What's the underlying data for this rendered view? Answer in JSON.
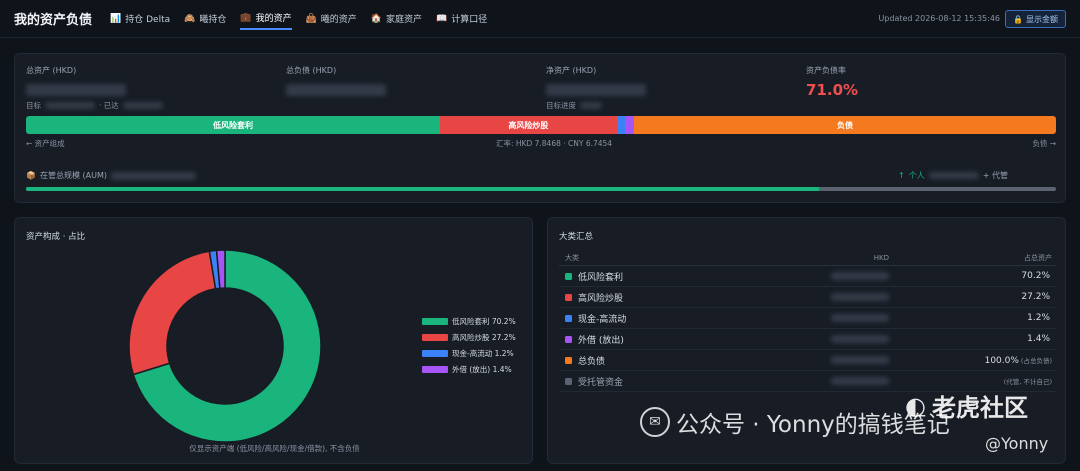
{
  "header": {
    "title": "我的资产负债",
    "nav": [
      {
        "icon": "📊",
        "label": "持仓 Delta",
        "active": false
      },
      {
        "icon": "🙈",
        "label": "曦持仓",
        "active": false
      },
      {
        "icon": "💼",
        "label": "我的资产",
        "active": true
      },
      {
        "icon": "👜",
        "label": "曦的资产",
        "active": false
      },
      {
        "icon": "🏠",
        "label": "家庭资产",
        "active": false
      },
      {
        "icon": "📖",
        "label": "计算口径",
        "active": false
      }
    ],
    "updated": "Updated 2026-08-12 15:35:46",
    "show_button": {
      "icon": "🔒",
      "label": "显示金额"
    }
  },
  "summary": {
    "total_assets_label": "总资产 (HKD)",
    "total_liab_label": "总负债 (HKD)",
    "net_assets_label": "净资产 (HKD)",
    "debt_ratio_label": "资产负债率",
    "debt_ratio_value": "71.0%",
    "target_label": "目标",
    "reached_label": "· 已达",
    "target_progress_label": "目标进度",
    "bar_segments": [
      {
        "label": "低风险套利",
        "share": 41,
        "color": "#19b57c"
      },
      {
        "label": "高风险炒股",
        "share": 17.5,
        "color": "#e84545"
      },
      {
        "label": "",
        "share": 0.8,
        "color": "#3b82f6"
      },
      {
        "label": "",
        "share": 0.9,
        "color": "#a855f7"
      },
      {
        "label": "负债",
        "share": 41.8,
        "color": "#f57a1f"
      }
    ],
    "asset_side_label": "← 资产组成",
    "fx_label": "汇率: HKD 7.8468 · CNY 6.7454",
    "liab_side_label": "负债 →",
    "aum_icon": "📦",
    "aum_label": "在管总规模 (AUM)",
    "aum_personal_label": "个人",
    "aum_agent_label": "+ 代管",
    "aum_personal_share": 0.77
  },
  "donut": {
    "title": "资产构成 · 占比",
    "note": "仅显示资产端 (低风险/高风险/现金/借款), 不含负债",
    "chart_data": {
      "type": "pie",
      "categories": [
        "低风险套利",
        "高风险炒股",
        "现金-高流动",
        "外借 (放出)"
      ],
      "values": [
        70.2,
        27.2,
        1.2,
        1.4
      ],
      "colors": [
        "#19b57c",
        "#e84545",
        "#3b82f6",
        "#a855f7"
      ],
      "legend_labels": [
        "低风险套利  70.2%",
        "高风险炒股  27.2%",
        "现金-高流动  1.2%",
        "外借 (放出)  1.4%"
      ]
    }
  },
  "table": {
    "title": "大类汇总",
    "headers": [
      "大类",
      "HKD",
      "占总资产"
    ],
    "rows": [
      {
        "name": "低风险套利",
        "color": "#19b57c",
        "pct": "70.2%",
        "note": ""
      },
      {
        "name": "高风险炒股",
        "color": "#e84545",
        "pct": "27.2%",
        "note": ""
      },
      {
        "name": "现金-高流动",
        "color": "#3b82f6",
        "pct": "1.2%",
        "note": ""
      },
      {
        "name": "外借 (放出)",
        "color": "#a855f7",
        "pct": "1.4%",
        "note": ""
      },
      {
        "name": "总负债",
        "color": "#f57a1f",
        "pct": "100.0%",
        "note": "(占总负债)"
      },
      {
        "name": "受托管资金",
        "color": "#5b6270",
        "pct": "",
        "note": "(代管, 不计自己)"
      }
    ]
  },
  "watermark": {
    "text": "公众号 · Yonny的搞钱笔记",
    "brand": "老虎社区",
    "handle": "@Yonny"
  }
}
